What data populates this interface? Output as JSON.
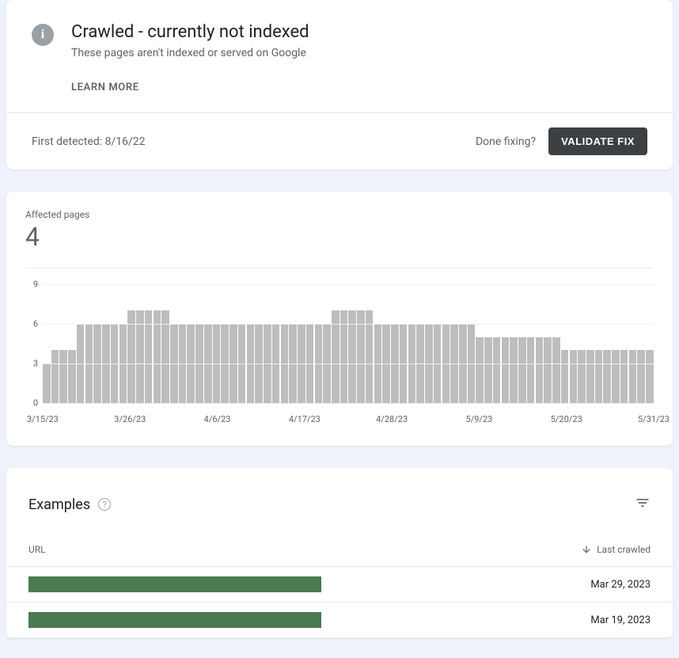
{
  "info": {
    "title": "Crawled - currently not indexed",
    "subtitle": "These pages aren't indexed or served on Google",
    "learn_more": "LEARN MORE",
    "first_detected_label": "First detected: 8/16/22",
    "done_fixing": "Done fixing?",
    "validate_btn": "VALIDATE FIX"
  },
  "chart_header": {
    "affected_label": "Affected pages",
    "affected_count": "4"
  },
  "chart_data": {
    "type": "bar",
    "title": "",
    "xlabel": "",
    "ylabel": "",
    "ylim": [
      0,
      9
    ],
    "y_ticks": [
      0,
      3,
      6,
      9
    ],
    "x_ticks": [
      "3/15/23",
      "3/26/23",
      "4/6/23",
      "4/17/23",
      "4/28/23",
      "5/9/23",
      "5/20/23",
      "5/31/23"
    ],
    "values": [
      3,
      4,
      4,
      4,
      6,
      6,
      6,
      6,
      6,
      6,
      7,
      7,
      7,
      7,
      7,
      6,
      6,
      6,
      6,
      6,
      6,
      6,
      6,
      6,
      6,
      6,
      6,
      6,
      6,
      6,
      6,
      6,
      6,
      6,
      7,
      7,
      7,
      7,
      7,
      6,
      6,
      6,
      6,
      6,
      6,
      6,
      6,
      6,
      6,
      6,
      6,
      5,
      5,
      5,
      5,
      5,
      5,
      5,
      5,
      5,
      5,
      4,
      4,
      4,
      4,
      4,
      4,
      4,
      4,
      4,
      4,
      4
    ]
  },
  "examples": {
    "title": "Examples",
    "col_url": "URL",
    "col_last_crawled": "Last crawled",
    "rows": [
      {
        "date": "Mar 29, 2023"
      },
      {
        "date": "Mar 19, 2023"
      }
    ]
  }
}
